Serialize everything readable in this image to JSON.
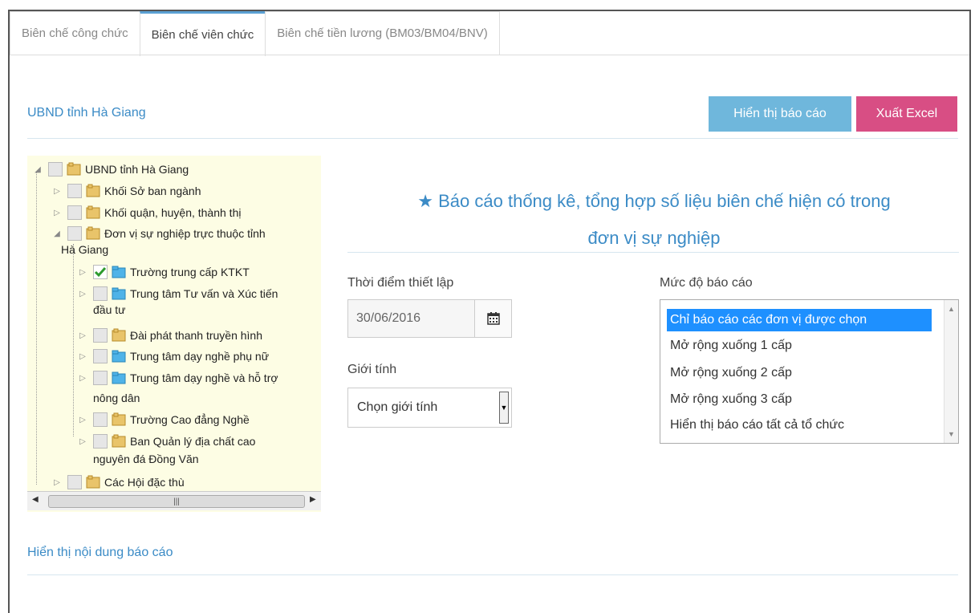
{
  "tabs": [
    {
      "label": "Biên chế công chức",
      "active": false
    },
    {
      "label": "Biên chế viên chức",
      "active": true
    },
    {
      "label": "Biên chế tiền lương (BM03/BM04/BNV)",
      "active": false
    }
  ],
  "header": {
    "unit_title": "UBND tỉnh Hà Giang",
    "show_report_label": "Hiển thị báo cáo",
    "export_excel_label": "Xuất Excel"
  },
  "tree": {
    "root": "UBND tỉnh Hà Giang",
    "items": [
      {
        "label": "Khối Sở ban ngành"
      },
      {
        "label": "Khối quận, huyện, thành thị"
      },
      {
        "label_line1": "Đơn vị sự nghiệp trực thuộc tỉnh",
        "label_line2": "Hà Giang"
      },
      {
        "label": "Trường trung cấp KTKT",
        "checked": true
      },
      {
        "label_line1": "Trung tâm Tư vấn và Xúc tiến",
        "label_line2": "đầu tư"
      },
      {
        "label": "Đài phát thanh truyền hình"
      },
      {
        "label": "Trung tâm dạy nghề phụ nữ"
      },
      {
        "label_line1": "Trung tâm dạy nghề và hỗ trợ",
        "label_line2": "nông dân"
      },
      {
        "label": "Trường Cao đẳng Nghề"
      },
      {
        "label_line1": "Ban Quản lý địa chất cao",
        "label_line2": "nguyên đá Đồng Văn"
      },
      {
        "label": "Các Hội đặc thù"
      }
    ]
  },
  "report": {
    "title_line1": "Báo cáo thống kê, tổng hợp số liệu biên chế hiện có trong",
    "title_line2": "đơn vị sự nghiệp",
    "date_label": "Thời điểm thiết lập",
    "date_value": "30/06/2016",
    "gender_label": "Giới tính",
    "gender_selected": "Chọn giới tính",
    "level_label": "Mức độ báo cáo",
    "level_options": [
      "Chỉ báo cáo các đơn vị được chọn",
      "Mở rộng xuống 1 cấp",
      "Mở rộng xuống 2 cấp",
      "Mở rộng xuống 3 cấp",
      "Hiển thị báo cáo tất cả tổ chức"
    ],
    "content_title": "Hiển thị nội dung báo cáo"
  },
  "colors": {
    "accent": "#3b8bc6",
    "show_button": "#6fb7dc",
    "excel_button": "#d84e84",
    "selected_option": "#1e90ff",
    "tree_bg": "#fdfde4"
  }
}
